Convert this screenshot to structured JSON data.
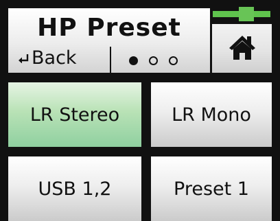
{
  "header": {
    "title": "HP Preset",
    "back_label": "Back",
    "page_indicator": {
      "total_pages": 3,
      "current_page": 1
    }
  },
  "level_meter": {
    "color": "#5fc34d"
  },
  "home_button": {
    "icon": "home-icon"
  },
  "presets": [
    {
      "label": "LR Stereo",
      "selected": true
    },
    {
      "label": "LR Mono",
      "selected": false
    },
    {
      "label": "USB 1,2",
      "selected": false
    },
    {
      "label": "Preset 1",
      "selected": false
    }
  ],
  "colors": {
    "selected_button": "#b9e2b6",
    "button": "#e6e6e6",
    "background": "#111111"
  }
}
